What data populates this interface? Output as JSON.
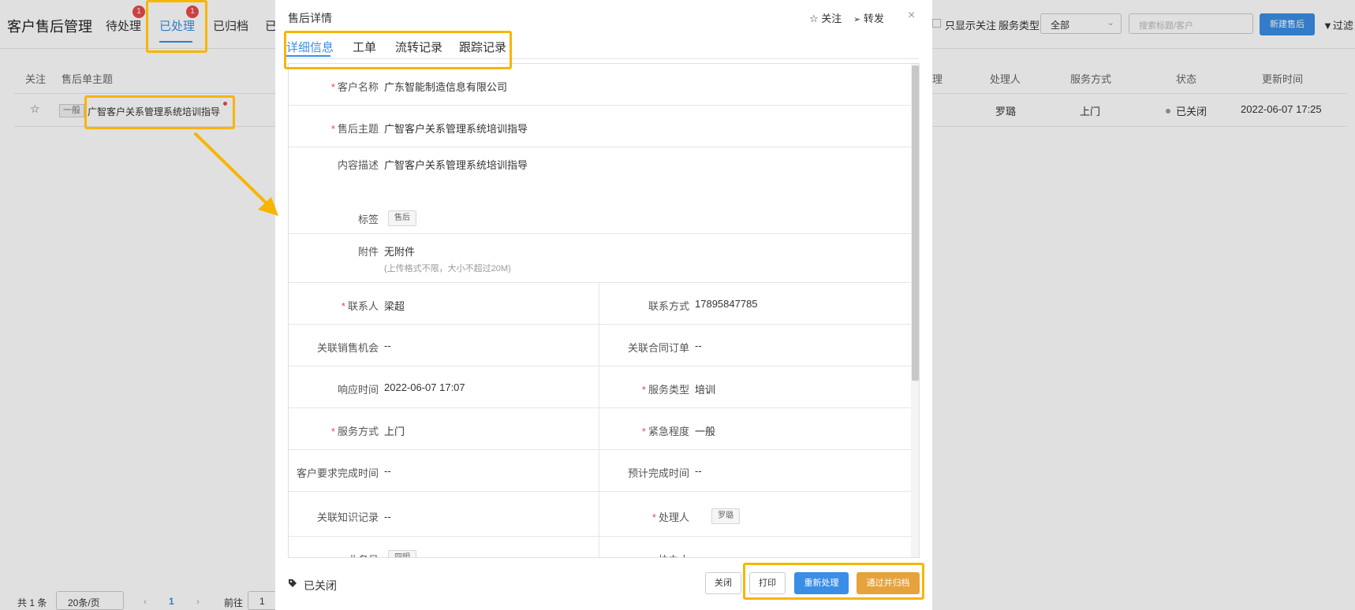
{
  "app": {
    "title": "客户售后管理",
    "tabs": [
      {
        "label": "待处理",
        "badge": "1"
      },
      {
        "label": "已处理",
        "badge": "1"
      },
      {
        "label": "已归档"
      },
      {
        "label": "已"
      }
    ]
  },
  "filters": {
    "only_follow_label": "只显示关注",
    "service_type_label": "服务类型",
    "service_type_value": "全部",
    "search_placeholder": "搜索标题/客户",
    "new_button": "新建售后",
    "filter_button": "▼过滤"
  },
  "table": {
    "headers": {
      "follow": "关注",
      "subject": "售后单主题",
      "handler_col_partial": "理",
      "handler": "处理人",
      "service_mode": "服务方式",
      "status": "状态",
      "updated": "更新时间"
    },
    "row": {
      "tag": "一般",
      "subject": "广智客户关系管理系统培训指导",
      "handler": "罗璐",
      "service_mode": "上门",
      "status": "已关闭",
      "updated": "2022-06-07 17:25"
    }
  },
  "pagination": {
    "total": "共 1 条",
    "page_size": "20条/页",
    "prev": "‹",
    "page": "1",
    "next": "›",
    "goto_label": "前往",
    "goto_value": "1"
  },
  "modal": {
    "title": "售后详情",
    "follow": "关注",
    "forward": "转发",
    "close": "×",
    "tabs": [
      "详细信息",
      "工单",
      "流转记录",
      "跟踪记录"
    ],
    "fields": {
      "customer_name": {
        "label": "客户名称",
        "value": "广东智能制造信息有限公司"
      },
      "subject": {
        "label": "售后主题",
        "value": "广智客户关系管理系统培训指导"
      },
      "description": {
        "label": "内容描述",
        "value": "广智客户关系管理系统培训指导"
      },
      "tags": {
        "label": "标签",
        "value": "售后"
      },
      "attachment": {
        "label": "附件",
        "value": "无附件",
        "hint": "(上传格式不限，大小不超过20M)"
      },
      "contact": {
        "label": "联系人",
        "value": "梁超"
      },
      "contact_info": {
        "label": "联系方式",
        "value": "17895847785"
      },
      "sales_opportunity": {
        "label": "关联销售机会",
        "value": "--"
      },
      "contract_order": {
        "label": "关联合同订单",
        "value": "--"
      },
      "response_time": {
        "label": "响应时间",
        "value": "2022-06-07 17:07"
      },
      "service_type": {
        "label": "服务类型",
        "value": "培训"
      },
      "service_mode": {
        "label": "服务方式",
        "value": "上门"
      },
      "urgency": {
        "label": "紧急程度",
        "value": "一般"
      },
      "customer_deadline": {
        "label": "客户要求完成时间",
        "value": "--"
      },
      "expected_finish": {
        "label": "预计完成时间",
        "value": "--"
      },
      "knowledge": {
        "label": "关联知识记录",
        "value": "--"
      },
      "handler": {
        "label": "处理人",
        "value": "罗璐"
      },
      "salesperson": {
        "label": "业务员",
        "value": "四明"
      },
      "collaborator": {
        "label": "协办人",
        "value": ""
      }
    },
    "status": "已关闭",
    "buttons": {
      "close": "关闭",
      "print": "打印",
      "reprocess": "重新处理",
      "approve_archive": "通过并归档"
    }
  },
  "colors": {
    "accent": "#3a8ee6",
    "highlight": "#f7b500",
    "orange": "#e6a23c",
    "required": "#e84a4a"
  }
}
